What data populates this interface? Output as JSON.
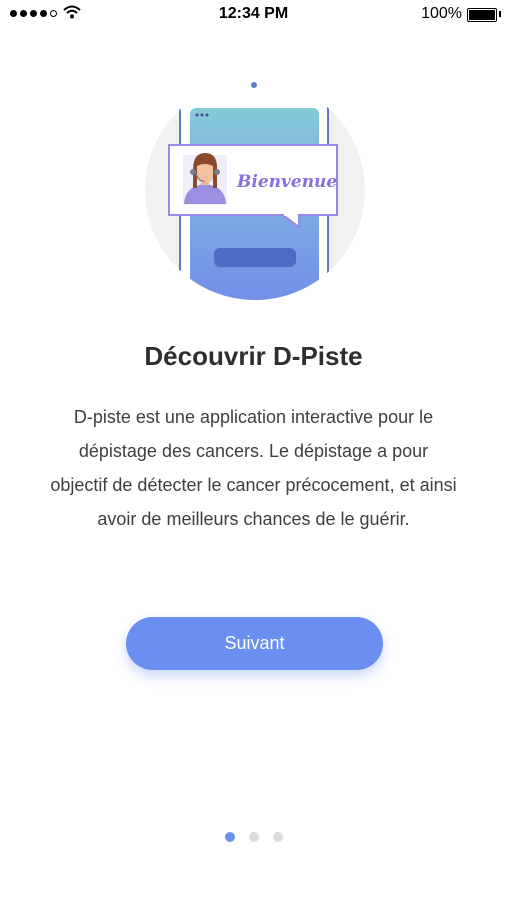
{
  "status_bar": {
    "signal_dots": 5,
    "signal_filled": 4,
    "time": "12:34 PM",
    "battery_percent": "100%"
  },
  "illustration": {
    "bubble_text": "Bienvenue"
  },
  "onboarding": {
    "title": "Découvrir D-Piste",
    "description": "D-piste est une application interactive pour le dépistage des cancers. Le dépistage a pour objectif de détecter le cancer précocement, et ainsi avoir de meilleurs chances de le guérir.",
    "next_label": "Suivant"
  },
  "pager": {
    "total": 3,
    "active_index": 0
  },
  "colors": {
    "accent": "#6b8ff0",
    "pager_inactive": "#dcdcdc",
    "text_title": "#2f2f2f",
    "text_body": "#3f3f3f"
  }
}
